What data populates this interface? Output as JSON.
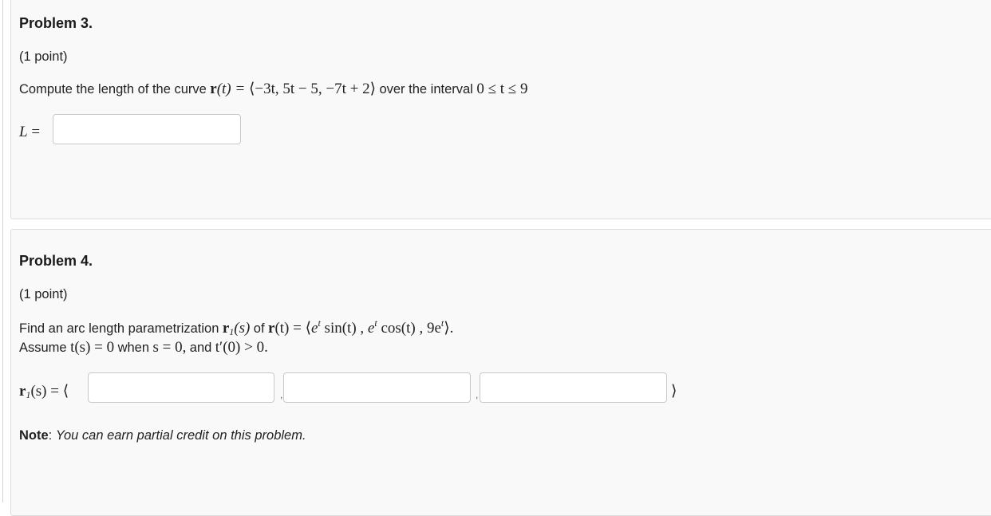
{
  "problem3": {
    "title": "Problem 3.",
    "points": "(1 point)",
    "prompt_prefix": "Compute the length of the curve",
    "curve_r": "r",
    "curve_arg": "(t) =",
    "curve_expr": "⟨−3t, 5t − 5, −7t + 2⟩",
    "prompt_mid": "over the interval",
    "interval": "0 ≤ t ≤ 9",
    "answer_label_var": "L",
    "answer_label_eq": "=",
    "answer_value": ""
  },
  "problem4": {
    "title": "Problem 4.",
    "points": "(1 point)",
    "line1_prefix": "Find an arc length parametrization",
    "r1_bold": "r",
    "r1_sub": "1",
    "r1_arg": "(s)",
    "line1_of": "of",
    "r_bold": "r",
    "r_arg_eq": "(t) = ⟨",
    "e1": "e",
    "t_sup1": "t",
    "sin_part": "sin(t) ,",
    "e2": "e",
    "t_sup2": "t",
    "cos_part": "cos(t) , 9e",
    "t_sup3": "t",
    "close_part": "⟩.",
    "line2_assume": "Assume",
    "line2_cond1": "t(s) = 0",
    "line2_when": "when",
    "line2_cond2": "s = 0,",
    "line2_and": "and",
    "line2_cond3": "t′(0) > 0.",
    "answer_label_r": "r",
    "answer_label_sub": "1",
    "answer_label_rest": "(s) = ⟨",
    "separator1": ",",
    "separator2": ",",
    "closing_bracket": "⟩",
    "answer_values": [
      "",
      "",
      ""
    ],
    "note_label": "Note",
    "note_colon": ":",
    "note_text": "You can earn partial credit on this problem."
  }
}
